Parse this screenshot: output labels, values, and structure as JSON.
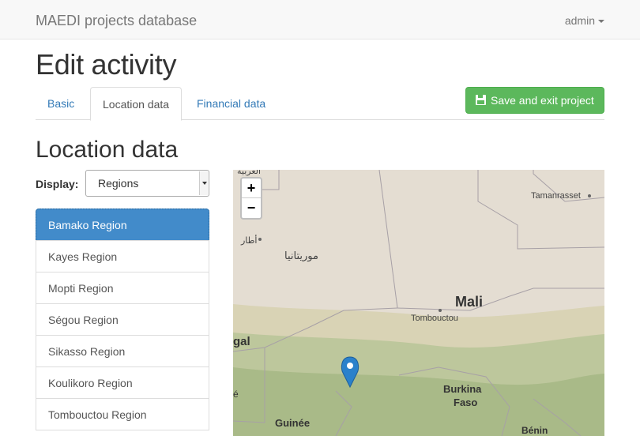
{
  "navbar": {
    "brand": "MAEDI projects database",
    "user": "admin"
  },
  "page": {
    "title": "Edit activity"
  },
  "tabs": [
    {
      "label": "Basic",
      "active": false
    },
    {
      "label": "Location data",
      "active": true
    },
    {
      "label": "Financial data",
      "active": false
    }
  ],
  "actions": {
    "save_label": "Save and exit project",
    "save_icon": "floppy-disk-icon"
  },
  "section": {
    "title": "Location data",
    "display_label": "Display:",
    "display_value": "Regions"
  },
  "regions": [
    {
      "label": "Bamako Region",
      "active": true
    },
    {
      "label": "Kayes Region",
      "active": false
    },
    {
      "label": "Mopti Region",
      "active": false
    },
    {
      "label": "Ségou Region",
      "active": false
    },
    {
      "label": "Sikasso Region",
      "active": false
    },
    {
      "label": "Koulikoro Region",
      "active": false
    },
    {
      "label": "Tombouctou Region",
      "active": false
    }
  ],
  "map": {
    "zoom_in": "+",
    "zoom_out": "−",
    "labels": {
      "top_edge": "العربية",
      "tamanrasset": "Tamanrasset",
      "atar": "أطار",
      "mauritania": "موريتانيا",
      "mali": "Mali",
      "tombouctou": "Tombouctou",
      "senegal": "gal",
      "burkina_line1": "Burkina",
      "burkina_line2": "Faso",
      "guinee": "Guinée",
      "benin": "Bénin",
      "e_fragment": "é"
    },
    "colors": {
      "desert": "#e4ddd2",
      "sahel": "#d9d3b5",
      "savanna": "#b9c59a",
      "marker": "#2a81cb"
    }
  }
}
